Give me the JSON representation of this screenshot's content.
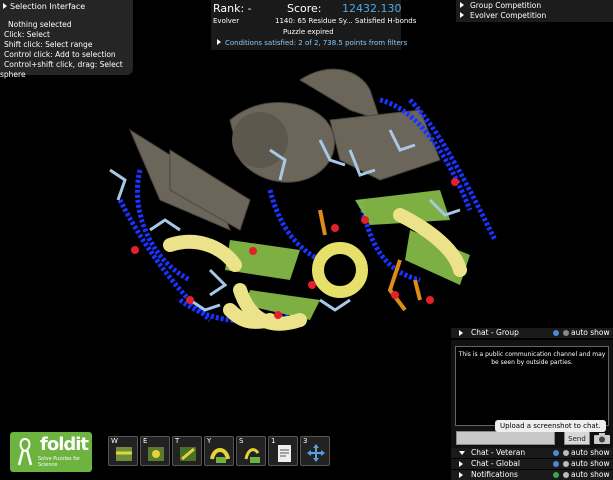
{
  "selection_panel": {
    "title": "Selection Interface",
    "lines": [
      "Nothing selected",
      "Click: Select",
      "Shift click: Select range",
      "Control click: Add to selection",
      "Control+shift click, drag: Select",
      "sphere"
    ]
  },
  "score_panel": {
    "rank_label": "Rank: -",
    "score_label": "Score:",
    "score_value": "12432.130",
    "player": "Evolver",
    "puzzle_title": "1140: 65 Residue Sy...  Satisfied H-bonds",
    "status": "Puzzle expired",
    "conditions": "Conditions satisfied: 2 of 2, 738.5 points from filters"
  },
  "competitions": {
    "items": [
      "Group Competition",
      "Evolver Competition"
    ]
  },
  "chat": {
    "group_label": "Chat - Group",
    "auto_show": "auto show",
    "message": "This is a public communication channel and may be seen by outside parties.",
    "tooltip": "Upload a screenshot to chat.",
    "send_label": "Send",
    "channels": [
      {
        "name": "Chat - Veteran",
        "auto": "auto show"
      },
      {
        "name": "Chat - Global",
        "auto": "auto show"
      },
      {
        "name": "Notifications",
        "auto": "auto show"
      }
    ]
  },
  "logo": {
    "brand": "foldit",
    "tagline": "Solve Puzzles for Science"
  },
  "toolbar": {
    "tools": [
      {
        "key": "W",
        "icon": "wiggle-all-icon"
      },
      {
        "key": "E",
        "icon": "shake-all-icon"
      },
      {
        "key": "T",
        "icon": "tweak-all-icon"
      },
      {
        "key": "Y",
        "icon": "rebuild-all-icon"
      },
      {
        "key": "S",
        "icon": "sidechain-all-icon"
      },
      {
        "key": "1",
        "icon": "notes-icon"
      },
      {
        "key": "3",
        "icon": "move-icon"
      }
    ]
  },
  "colors": {
    "score_blue": "#4fa8e8",
    "hbond_blue": "#1a33ff",
    "logo_green": "#6cb33f"
  }
}
